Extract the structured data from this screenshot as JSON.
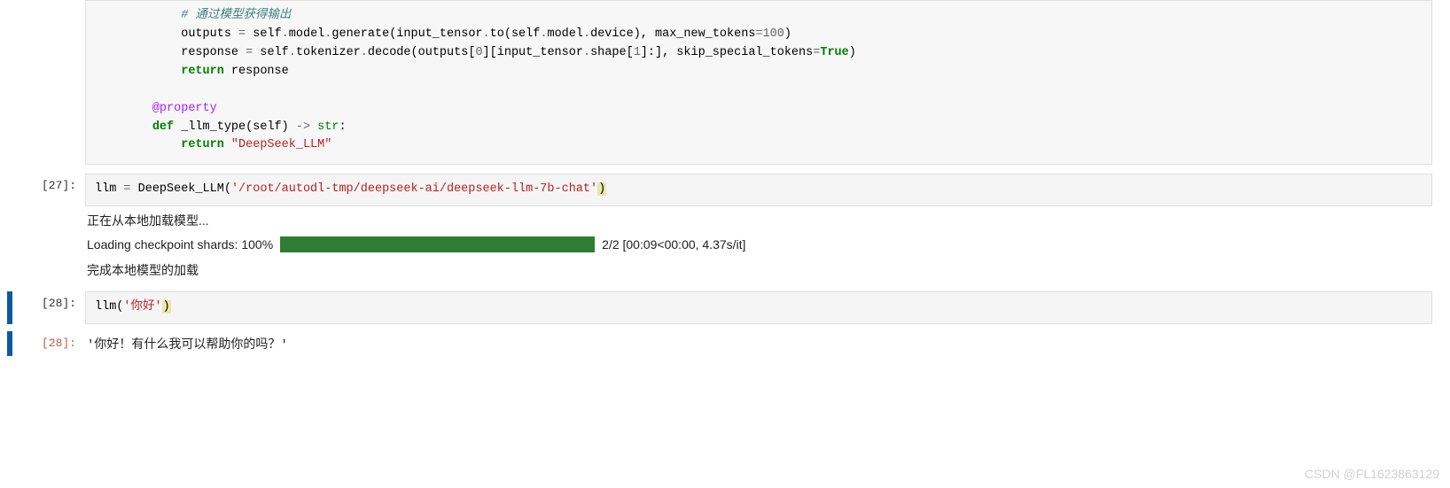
{
  "cell_code_top": {
    "comment": "# 通过模型获得输出",
    "line1_p1": "            outputs ",
    "line1_op1": "=",
    "line1_p2": " self",
    "line1_op2": ".",
    "line1_p3": "model",
    "line1_op3": ".",
    "line1_p4": "generate(input_tensor",
    "line1_op4": ".",
    "line1_p5": "to(self",
    "line1_op5": ".",
    "line1_p6": "model",
    "line1_op6": ".",
    "line1_p7": "device), max_new_tokens",
    "line1_op7": "=",
    "line1_num": "100",
    "line1_p8": ")",
    "line2_p1": "            response ",
    "line2_op1": "=",
    "line2_p2": " self",
    "line2_op2": ".",
    "line2_p3": "tokenizer",
    "line2_op3": ".",
    "line2_p4": "decode(outputs[",
    "line2_num1": "0",
    "line2_p5": "][input_tensor",
    "line2_op4": ".",
    "line2_p6": "shape[",
    "line2_num2": "1",
    "line2_p7": "]:], skip_special_tokens",
    "line2_op5": "=",
    "line2_bool": "True",
    "line2_p8": ")",
    "line3_kw": "return",
    "line3_rest": " response",
    "decor": "@property",
    "def_kw": "def",
    "def_name": " _llm_type(self) ",
    "def_arrow": "->",
    "def_type": " str",
    "def_colon": ":",
    "ret_kw": "return",
    "ret_str": " \"DeepSeek_LLM\""
  },
  "cell27": {
    "prompt": "[27]:",
    "code_p1": "llm ",
    "code_op1": "=",
    "code_p2": " DeepSeek_LLM(",
    "code_str": "'/root/autodl-tmp/deepseek-ai/deepseek-llm-7b-chat'",
    "code_p3": ")",
    "out1": "正在从本地加载模型...",
    "progress_label": "Loading checkpoint shards: 100%",
    "progress_info": "2/2 [00:09<00:00, 4.37s/it]",
    "out2": "完成本地模型的加载"
  },
  "cell28": {
    "prompt": "[28]:",
    "code_p1": "llm(",
    "code_str": "'你好'",
    "code_p2": ")",
    "out_prompt": "[28]:",
    "output": "'你好！有什么我可以帮助你的吗？'"
  },
  "watermark": "CSDN @FL1623863129"
}
